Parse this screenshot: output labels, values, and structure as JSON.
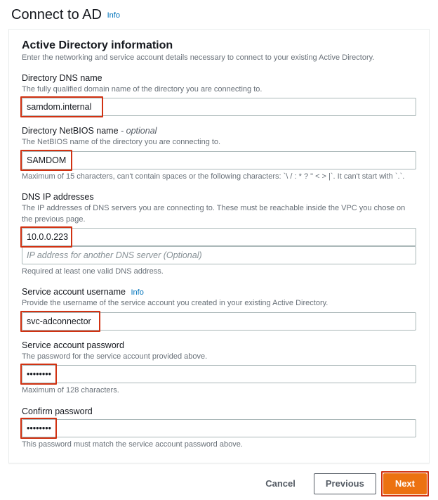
{
  "header": {
    "title": "Connect to AD",
    "info": "Info"
  },
  "panel": {
    "title": "Active Directory information",
    "desc": "Enter the networking and service account details necessary to connect to your existing Active Directory."
  },
  "fields": {
    "dnsName": {
      "label": "Directory DNS name",
      "help": "The fully qualified domain name of the directory you are connecting to.",
      "value": "samdom.internal"
    },
    "netbios": {
      "label": "Directory NetBIOS name",
      "optional": " - optional",
      "help": "The NetBIOS name of the directory you are connecting to.",
      "value": "SAMDOM",
      "helpBelow": "Maximum of 15 characters, can't contain spaces or the following characters: `\\ / : * ? \" < > |`. It can't start with `.`."
    },
    "dnsIp": {
      "label": "DNS IP addresses",
      "help": "The IP addresses of DNS servers you are connecting to. These must be reachable inside the VPC you chose on the previous page.",
      "value1": "10.0.0.223",
      "placeholder2": "IP address for another DNS server (Optional)",
      "helpBelow": "Required at least one valid DNS address."
    },
    "svcUser": {
      "label": "Service account username",
      "info": "Info",
      "help": "Provide the username of the service account you created in your existing Active Directory.",
      "value": "svc-adconnector"
    },
    "svcPass": {
      "label": "Service account password",
      "help": "The password for the service account provided above.",
      "value": "••••••••",
      "helpBelow": "Maximum of 128 characters."
    },
    "confirmPass": {
      "label": "Confirm password",
      "value": "••••••••",
      "helpBelow": "This password must match the service account password above."
    }
  },
  "footer": {
    "cancel": "Cancel",
    "previous": "Previous",
    "next": "Next"
  }
}
